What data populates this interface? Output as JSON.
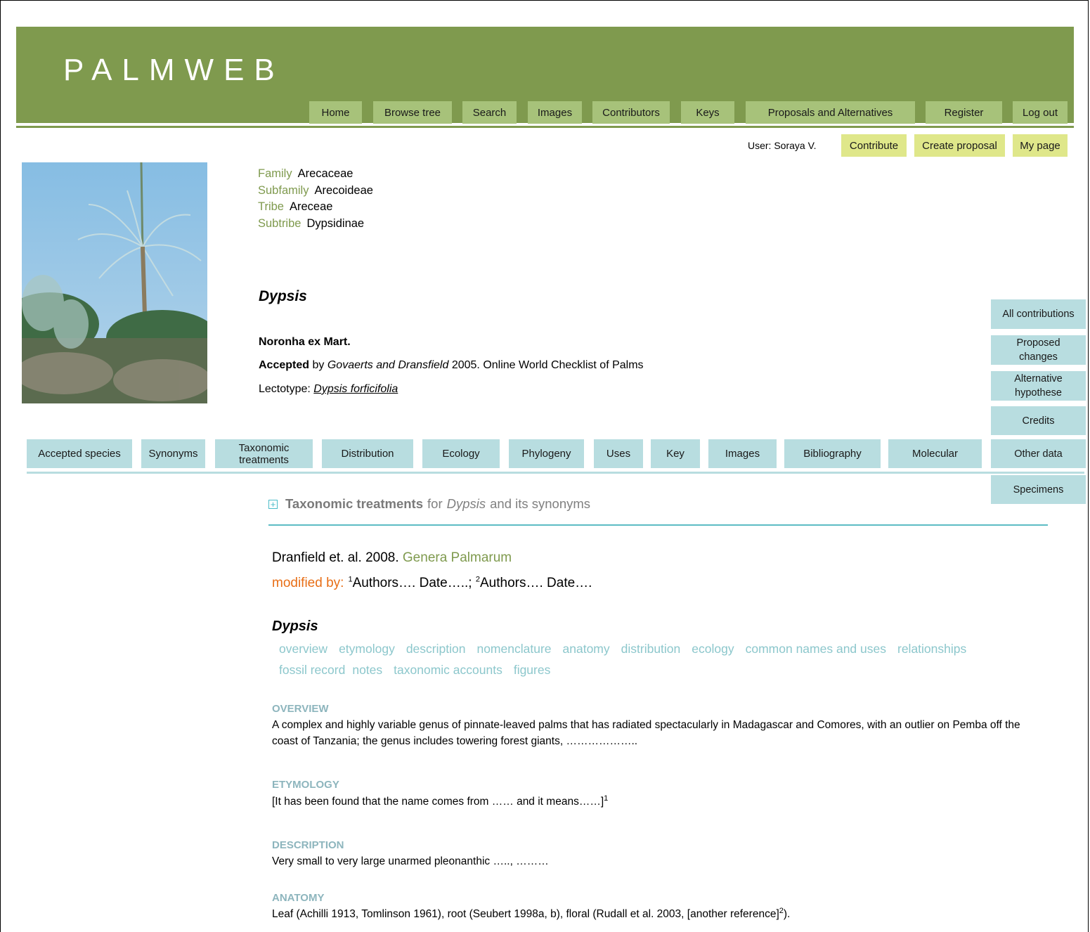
{
  "site_title": "PALMWEB",
  "nav": [
    "Home",
    "Browse tree",
    "Search",
    "Images",
    "Contributors",
    "Keys",
    "Proposals and Alternatives",
    "Register",
    "Log out"
  ],
  "user": {
    "label": "User: Soraya V.",
    "buttons": [
      "Contribute",
      "Create proposal",
      "My page"
    ]
  },
  "taxonomy": [
    {
      "key": "Family",
      "value": "Arecaceae"
    },
    {
      "key": "Subfamily",
      "value": "Arecoideae"
    },
    {
      "key": "Tribe",
      "value": "Areceae"
    },
    {
      "key": "Subtribe",
      "value": "Dypsidinae"
    }
  ],
  "genus": {
    "name": "Dypsis",
    "author": "Noronha ex Mart.",
    "accepted_label": "Accepted",
    "accepted_by": "by",
    "accepted_source_authors": "Govaerts and Dransfield",
    "accepted_source_rest": "2005. Online World Checklist of Palms",
    "lectotype_label": "Lectotype:",
    "lectotype_name": "Dypsis forficifolia"
  },
  "side_menu": [
    "All contributions",
    "Proposed changes",
    "Alternative hypothese",
    "Credits",
    "Other data",
    "Specimens"
  ],
  "tabs": [
    "Accepted species",
    "Synonyms",
    "Taxonomic treatments",
    "Distribution",
    "Ecology",
    "Phylogeny",
    "Uses",
    "Key",
    "Images",
    "Bibliography",
    "Molecular"
  ],
  "section": {
    "title": "Taxonomic treatments",
    "for": "for",
    "genus": "Dypsis",
    "rest": "and its synonyms"
  },
  "reference": {
    "authors": "Dranfield et. al. 2008.",
    "work": "Genera Palmarum",
    "modified_label": "modified by:",
    "mod1_sup": "1",
    "mod1": "Authors…. Date…..;",
    "mod2_sup": "2",
    "mod2": "Authors…. Date…."
  },
  "treatment_genus": "Dypsis",
  "toc_row1": [
    "overview",
    "etymology",
    "description",
    "nomenclature",
    "anatomy",
    "distribution",
    "ecology",
    "common  names and uses",
    "relationships"
  ],
  "toc_row2": [
    "fossil record",
    "notes",
    "taxonomic  accounts",
    "figures"
  ],
  "sections": {
    "overview": {
      "heading": "OVERVIEW",
      "text": "A complex and highly variable genus of pinnate-leaved palms that has radiated spectacularly in Madagascar and Comores, with an outlier on Pemba off the coast of Tanzania; the genus includes towering forest giants, ……………….."
    },
    "etymology": {
      "heading": "ETYMOLOGY",
      "text": "[It has been found that the name comes from …… and it means……]",
      "sup": "1"
    },
    "description": {
      "heading": "DESCRIPTION",
      "text": "Very small to very large unarmed pleonanthic ….., ………"
    },
    "anatomy": {
      "heading": "ANATOMY",
      "text": "Leaf (Achilli 1913, Tomlinson 1961), root (Seubert 1998a, b), floral (Rudall et al. 2003, [another reference]",
      "sup": "2",
      "tail": ")."
    }
  },
  "colors": {
    "banner": "#7f9a4e",
    "nav_button": "#a7c27a",
    "user_button": "#dfe78a",
    "tab": "#b8dde0",
    "accent_orange": "#e86f17",
    "toc_link": "#8cc7cc"
  }
}
